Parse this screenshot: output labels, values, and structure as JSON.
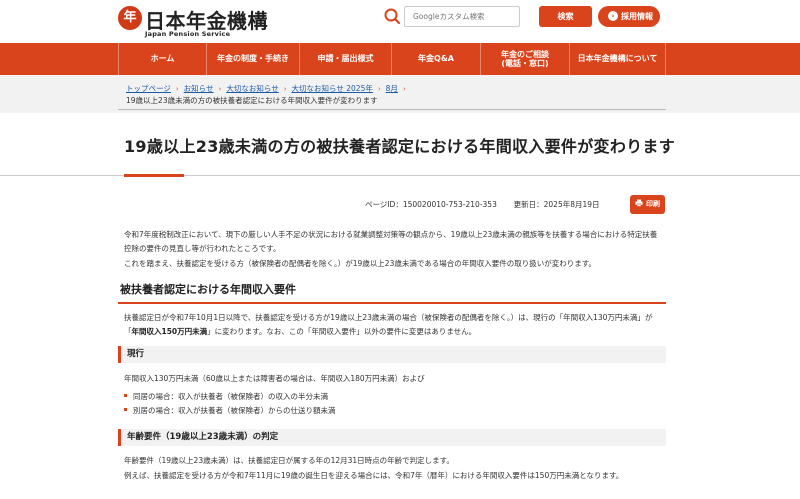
{
  "header": {
    "logo_mark": "年",
    "logo_text": "日本年金機構",
    "logo_sub": "Japan Pension Service",
    "search_placeholder": "Googleカスタム検索",
    "search_button": "検索",
    "recruit_button": "採用情報",
    "recruit_chevron": "›"
  },
  "nav": {
    "items": [
      {
        "label": "ホーム"
      },
      {
        "label": "年金の制度・手続き"
      },
      {
        "label": "申請・届出様式"
      },
      {
        "label": "年金Q&A"
      },
      {
        "label": "年金のご相談\n(電話・窓口)"
      },
      {
        "label": "日本年金機構について"
      }
    ]
  },
  "breadcrumb": {
    "links": [
      "トップページ",
      "お知らせ",
      "大切なお知らせ",
      "大切なお知らせ 2025年",
      "8月"
    ],
    "separator": "›",
    "current": "19歳以上23歳未満の方の被扶養者認定における年間収入要件が変わります"
  },
  "page": {
    "title": "19歳以上23歳未満の方の被扶養者認定における年間収入要件が変わります",
    "page_id": "ページID：150020010-753-210-353",
    "updated": "更新日：2025年8月19日",
    "print_label": "印刷",
    "intro_1": "令和7年度税制改正において、現下の厳しい人手不足の状況における就業調整対策等の観点から、19歳以上23歳未満の親族等を扶養する場合における特定扶養控除の要件の見直し等が行われたところです。",
    "intro_2": "これを踏まえ、扶養認定を受ける方（被保険者の配偶者を除く。）が19歳以上23歳未満である場合の年間収入要件の取り扱いが変わります。",
    "section_title": "被扶養者認定における年間収入要件",
    "section_p1": "扶養認定日が令和7年10月1日以降で、扶養認定を受ける方が19歳以上23歳未満の場合（被保険者の配偶者を除く。）は、現行の「年間収入130万円未満」が「",
    "section_p1_bold": "年間収入150万円未満",
    "section_p1_end": "」に変わります。なお、この「年間収入要件」以外の要件に変更はありません。",
    "current_title": "現行",
    "current_text": "年間収入130万円未満（60歳以上または障害者の場合は、年間収入180万円未満）および",
    "bullets": [
      "同居の場合：収入が扶養者（被保険者）の収入の半分未満",
      "別居の場合：収入が扶養者（被保険者）からの仕送り額未満"
    ],
    "age_title": "年齢要件（19歳以上23歳未満）の判定",
    "age_text_1": "年齢要件（19歳以上23歳未満）は、扶養認定日が属する年の12月31日時点の年齢で判定します。",
    "age_text_2": "例えば、扶養認定を受ける方が令和7年11月に19歳の誕生日を迎える場合には、令和7年（暦年）における年間収入要件は150万円未満となります。"
  },
  "colors": {
    "accent": "#d9441c",
    "link": "#1a5ba8"
  }
}
